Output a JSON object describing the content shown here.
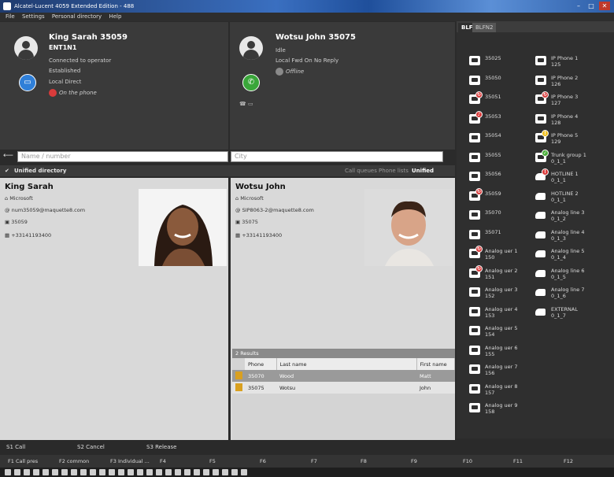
{
  "window": {
    "title": "Alcatel-Lucent 4059 Extended Edition - 488"
  },
  "menu": [
    "File",
    "Settings",
    "Personal directory",
    "Help"
  ],
  "operator": {
    "name": "King Sarah 35059",
    "id": "ENT1N1",
    "lines": [
      "Connected to operator",
      "Established",
      "Local Direct"
    ],
    "status": "On the phone"
  },
  "caller": {
    "name": "Wotsu John 35075",
    "lines": [
      "Idle",
      "Local Fwd On No Reply"
    ],
    "status": "Offline"
  },
  "search": {
    "name_placeholder": "Name / number",
    "city_placeholder": "City"
  },
  "directory": {
    "title": "Unified directory",
    "tabs": [
      "Call queues",
      "Phone lists",
      "Unified directory"
    ]
  },
  "cards": [
    {
      "name": "King Sarah",
      "company": "Microsoft",
      "email": "num35059@maquette8.com",
      "ext": "35059",
      "phone": "+33141193400"
    },
    {
      "name": "Wotsu John",
      "company": "Microsoft",
      "email": "SIP8063-2@maquette8.com",
      "ext": "35075",
      "phone": "+33141193400"
    }
  ],
  "results": {
    "count": "2 Results",
    "columns": [
      "Phone",
      "Last name",
      "First name"
    ],
    "rows": [
      {
        "phone": "35070",
        "last": "Wood",
        "first": "Matt"
      },
      {
        "phone": "35075",
        "last": "Wotsu",
        "first": "John"
      }
    ]
  },
  "blf": {
    "tabs": [
      "BLF",
      "BLFN2"
    ],
    "left": [
      {
        "label": "35025",
        "icon": "phone-icon",
        "badge": ""
      },
      {
        "label": "35050",
        "icon": "phone-icon",
        "badge": ""
      },
      {
        "label": "35051",
        "icon": "phone-icon",
        "badge": "busy"
      },
      {
        "label": "35053",
        "icon": "phone-icon",
        "badge": "ring"
      },
      {
        "label": "35054",
        "icon": "phone-icon",
        "badge": ""
      },
      {
        "label": "35055",
        "icon": "phone-icon",
        "badge": ""
      },
      {
        "label": "35056",
        "icon": "phone-icon",
        "badge": ""
      },
      {
        "label": "35059",
        "icon": "phone-icon",
        "badge": "busy"
      },
      {
        "label": "35070",
        "icon": "phone-icon",
        "badge": ""
      },
      {
        "label": "35071",
        "icon": "phone-icon",
        "badge": ""
      },
      {
        "label": "Analog uer 1\n150",
        "icon": "phone-icon",
        "badge": "busy"
      },
      {
        "label": "Analog uer 2\n151",
        "icon": "phone-icon",
        "badge": "busy"
      },
      {
        "label": "Analog uer 3\n152",
        "icon": "phone-icon",
        "badge": ""
      },
      {
        "label": "Analog uer 4\n153",
        "icon": "phone-icon",
        "badge": ""
      },
      {
        "label": "Analog uer 5\n154",
        "icon": "phone-icon",
        "badge": ""
      },
      {
        "label": "Analog uer 6\n155",
        "icon": "phone-icon",
        "badge": ""
      },
      {
        "label": "Analog uer 7\n156",
        "icon": "phone-icon",
        "badge": ""
      },
      {
        "label": "Analog uer 8\n157",
        "icon": "phone-icon",
        "badge": ""
      },
      {
        "label": "Analog uer 9\n158",
        "icon": "phone-icon",
        "badge": ""
      }
    ],
    "right": [
      {
        "label": "IP Phone 1\n125",
        "icon": "phone-icon",
        "badge": ""
      },
      {
        "label": "IP Phone 2\n126",
        "icon": "phone-icon",
        "badge": ""
      },
      {
        "label": "IP Phone 3\n127",
        "icon": "phone-icon",
        "badge": "busy"
      },
      {
        "label": "IP Phone 4\n128",
        "icon": "phone-icon",
        "badge": ""
      },
      {
        "label": "IP Phone 5\n129",
        "icon": "phone-icon",
        "badge": "warn"
      },
      {
        "label": "Trunk group 1\n0_1_1",
        "icon": "trunk-icon",
        "badge": "ok"
      },
      {
        "label": "HOTLINE 1\n0_1_1",
        "icon": "handset-icon",
        "badge": "alert"
      },
      {
        "label": "HOTLINE 2\n0_1_1",
        "icon": "handset-icon",
        "badge": ""
      },
      {
        "label": "Analog line 3\n0_1_2",
        "icon": "handset-icon",
        "badge": ""
      },
      {
        "label": "Analog line 4\n0_1_3",
        "icon": "handset-icon",
        "badge": ""
      },
      {
        "label": "Analog line 5\n0_1_4",
        "icon": "handset-icon",
        "badge": ""
      },
      {
        "label": "Analog line 6\n0_1_5",
        "icon": "handset-icon",
        "badge": ""
      },
      {
        "label": "Analog line 7\n0_1_6",
        "icon": "handset-icon",
        "badge": ""
      },
      {
        "label": "EXTERNAL\n0_1_7",
        "icon": "handset-icon",
        "badge": ""
      }
    ]
  },
  "softkeys": [
    "S1 Call",
    "S2 Cancel",
    "S3 Release"
  ],
  "fkeys": [
    "F1 Call pres",
    "F2 common",
    "F3 Individual ...",
    "F4",
    "F5",
    "F6",
    "F7",
    "F8",
    "F9",
    "F10",
    "F11",
    "F12"
  ],
  "colors": {
    "busy": "#d93b3b",
    "ok": "#4caf3c",
    "warn": "#f0c020",
    "answer": "#3aa63a",
    "chat": "#2f7fd8"
  }
}
